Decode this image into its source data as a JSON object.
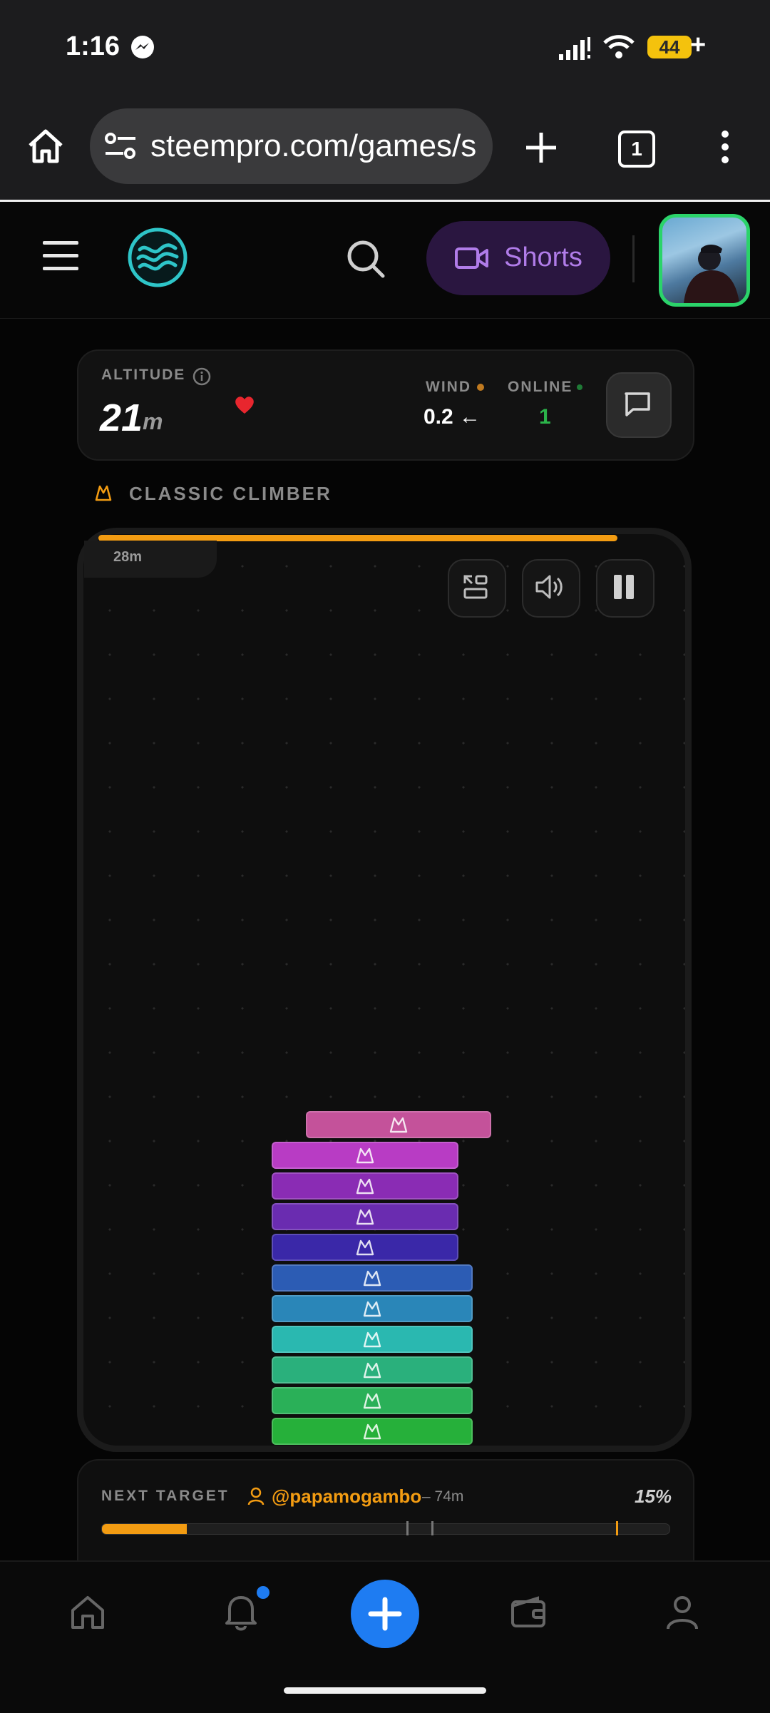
{
  "status_bar": {
    "time": "1:16",
    "battery": "44",
    "battery_plus": "+"
  },
  "browser": {
    "url": "steempro.com/games/s",
    "tab_count": "1"
  },
  "header": {
    "shorts_label": "Shorts"
  },
  "stats": {
    "altitude_label": "ALTITUDE",
    "altitude_value": "21",
    "altitude_unit": "m",
    "wind_label": "WIND",
    "wind_value": "0.2 ←",
    "online_label": "ONLINE",
    "online_value": "1"
  },
  "game": {
    "mode_title": "CLASSIC CLIMBER",
    "record_height": "28m",
    "top_progress_fraction": 0.86,
    "block_colors": [
      "#c4529a",
      "#b83cc4",
      "#8a2cb4",
      "#6a2cb0",
      "#3a28a8",
      "#2c5cb4",
      "#2a86b8",
      "#2ab8b0",
      "#2ab07c",
      "#2ab058",
      "#26b03a"
    ]
  },
  "next_target": {
    "label": "NEXT TARGET",
    "user": "@papamogambo",
    "distance": "– 74m",
    "percent": "15%",
    "progress_fraction": 0.15
  },
  "colors": {
    "accent": "#f39c12",
    "primary": "#1e7cf2",
    "online": "#2bb44a"
  }
}
